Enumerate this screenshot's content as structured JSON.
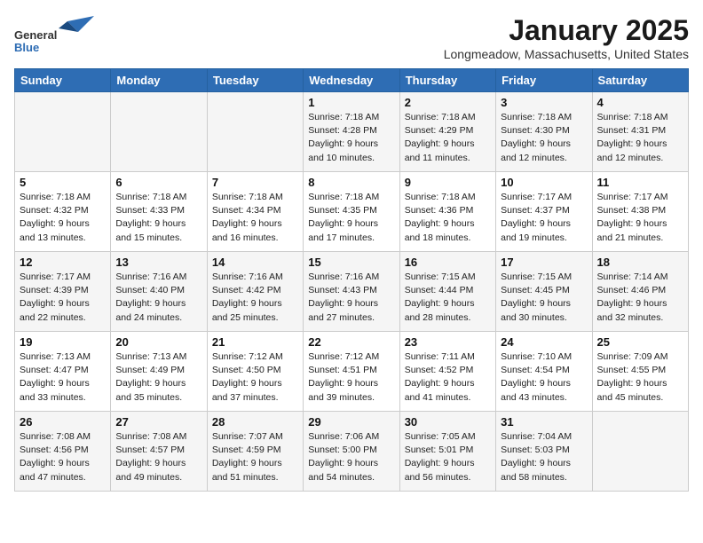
{
  "logo": {
    "line1": "General",
    "line2": "Blue"
  },
  "title": "January 2025",
  "location": "Longmeadow, Massachusetts, United States",
  "weekdays": [
    "Sunday",
    "Monday",
    "Tuesday",
    "Wednesday",
    "Thursday",
    "Friday",
    "Saturday"
  ],
  "weeks": [
    [
      {
        "day": "",
        "info": ""
      },
      {
        "day": "",
        "info": ""
      },
      {
        "day": "",
        "info": ""
      },
      {
        "day": "1",
        "info": "Sunrise: 7:18 AM\nSunset: 4:28 PM\nDaylight: 9 hours\nand 10 minutes."
      },
      {
        "day": "2",
        "info": "Sunrise: 7:18 AM\nSunset: 4:29 PM\nDaylight: 9 hours\nand 11 minutes."
      },
      {
        "day": "3",
        "info": "Sunrise: 7:18 AM\nSunset: 4:30 PM\nDaylight: 9 hours\nand 12 minutes."
      },
      {
        "day": "4",
        "info": "Sunrise: 7:18 AM\nSunset: 4:31 PM\nDaylight: 9 hours\nand 12 minutes."
      }
    ],
    [
      {
        "day": "5",
        "info": "Sunrise: 7:18 AM\nSunset: 4:32 PM\nDaylight: 9 hours\nand 13 minutes."
      },
      {
        "day": "6",
        "info": "Sunrise: 7:18 AM\nSunset: 4:33 PM\nDaylight: 9 hours\nand 15 minutes."
      },
      {
        "day": "7",
        "info": "Sunrise: 7:18 AM\nSunset: 4:34 PM\nDaylight: 9 hours\nand 16 minutes."
      },
      {
        "day": "8",
        "info": "Sunrise: 7:18 AM\nSunset: 4:35 PM\nDaylight: 9 hours\nand 17 minutes."
      },
      {
        "day": "9",
        "info": "Sunrise: 7:18 AM\nSunset: 4:36 PM\nDaylight: 9 hours\nand 18 minutes."
      },
      {
        "day": "10",
        "info": "Sunrise: 7:17 AM\nSunset: 4:37 PM\nDaylight: 9 hours\nand 19 minutes."
      },
      {
        "day": "11",
        "info": "Sunrise: 7:17 AM\nSunset: 4:38 PM\nDaylight: 9 hours\nand 21 minutes."
      }
    ],
    [
      {
        "day": "12",
        "info": "Sunrise: 7:17 AM\nSunset: 4:39 PM\nDaylight: 9 hours\nand 22 minutes."
      },
      {
        "day": "13",
        "info": "Sunrise: 7:16 AM\nSunset: 4:40 PM\nDaylight: 9 hours\nand 24 minutes."
      },
      {
        "day": "14",
        "info": "Sunrise: 7:16 AM\nSunset: 4:42 PM\nDaylight: 9 hours\nand 25 minutes."
      },
      {
        "day": "15",
        "info": "Sunrise: 7:16 AM\nSunset: 4:43 PM\nDaylight: 9 hours\nand 27 minutes."
      },
      {
        "day": "16",
        "info": "Sunrise: 7:15 AM\nSunset: 4:44 PM\nDaylight: 9 hours\nand 28 minutes."
      },
      {
        "day": "17",
        "info": "Sunrise: 7:15 AM\nSunset: 4:45 PM\nDaylight: 9 hours\nand 30 minutes."
      },
      {
        "day": "18",
        "info": "Sunrise: 7:14 AM\nSunset: 4:46 PM\nDaylight: 9 hours\nand 32 minutes."
      }
    ],
    [
      {
        "day": "19",
        "info": "Sunrise: 7:13 AM\nSunset: 4:47 PM\nDaylight: 9 hours\nand 33 minutes."
      },
      {
        "day": "20",
        "info": "Sunrise: 7:13 AM\nSunset: 4:49 PM\nDaylight: 9 hours\nand 35 minutes."
      },
      {
        "day": "21",
        "info": "Sunrise: 7:12 AM\nSunset: 4:50 PM\nDaylight: 9 hours\nand 37 minutes."
      },
      {
        "day": "22",
        "info": "Sunrise: 7:12 AM\nSunset: 4:51 PM\nDaylight: 9 hours\nand 39 minutes."
      },
      {
        "day": "23",
        "info": "Sunrise: 7:11 AM\nSunset: 4:52 PM\nDaylight: 9 hours\nand 41 minutes."
      },
      {
        "day": "24",
        "info": "Sunrise: 7:10 AM\nSunset: 4:54 PM\nDaylight: 9 hours\nand 43 minutes."
      },
      {
        "day": "25",
        "info": "Sunrise: 7:09 AM\nSunset: 4:55 PM\nDaylight: 9 hours\nand 45 minutes."
      }
    ],
    [
      {
        "day": "26",
        "info": "Sunrise: 7:08 AM\nSunset: 4:56 PM\nDaylight: 9 hours\nand 47 minutes."
      },
      {
        "day": "27",
        "info": "Sunrise: 7:08 AM\nSunset: 4:57 PM\nDaylight: 9 hours\nand 49 minutes."
      },
      {
        "day": "28",
        "info": "Sunrise: 7:07 AM\nSunset: 4:59 PM\nDaylight: 9 hours\nand 51 minutes."
      },
      {
        "day": "29",
        "info": "Sunrise: 7:06 AM\nSunset: 5:00 PM\nDaylight: 9 hours\nand 54 minutes."
      },
      {
        "day": "30",
        "info": "Sunrise: 7:05 AM\nSunset: 5:01 PM\nDaylight: 9 hours\nand 56 minutes."
      },
      {
        "day": "31",
        "info": "Sunrise: 7:04 AM\nSunset: 5:03 PM\nDaylight: 9 hours\nand 58 minutes."
      },
      {
        "day": "",
        "info": ""
      }
    ]
  ]
}
